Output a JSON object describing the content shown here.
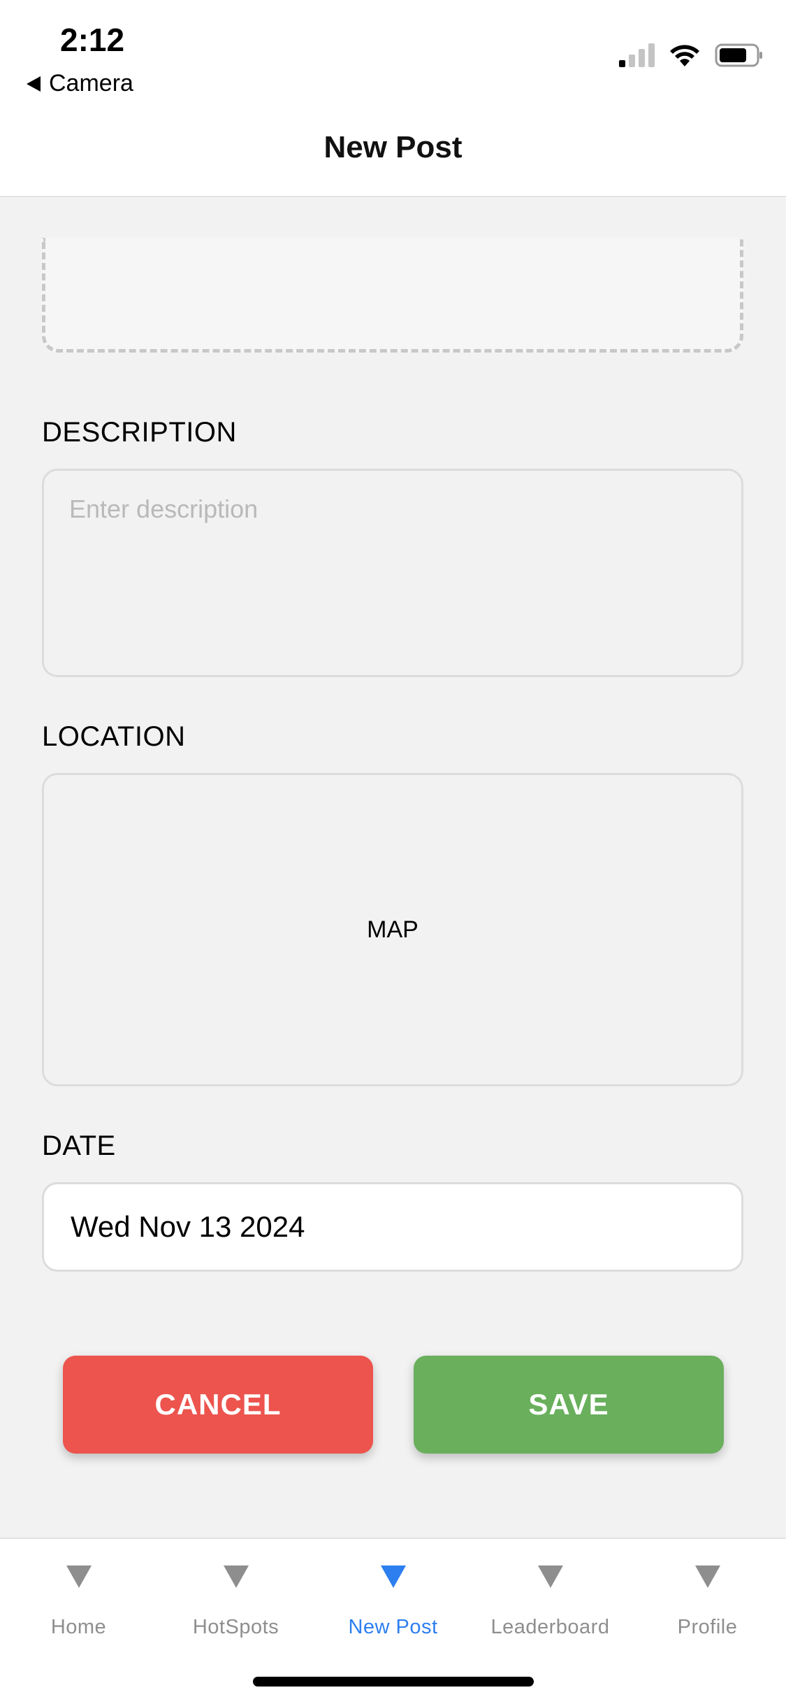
{
  "status_bar": {
    "time": "2:12",
    "back_label": "Camera",
    "signal_icon": "cellular-signal-icon",
    "wifi_icon": "wifi-icon",
    "battery_icon": "battery-icon"
  },
  "nav": {
    "title": "New Post"
  },
  "form": {
    "description_label": "DESCRIPTION",
    "description_placeholder": "Enter description",
    "location_label": "LOCATION",
    "map_text": "MAP",
    "date_label": "DATE",
    "date_value": "Wed Nov 13 2024"
  },
  "actions": {
    "cancel_label": "CANCEL",
    "save_label": "SAVE"
  },
  "tabbar": {
    "items": [
      {
        "label": "Home",
        "icon": "triangle-down-icon"
      },
      {
        "label": "HotSpots",
        "icon": "triangle-down-icon"
      },
      {
        "label": "New Post",
        "icon": "triangle-down-icon",
        "active": true
      },
      {
        "label": "Leaderboard",
        "icon": "triangle-down-icon"
      },
      {
        "label": "Profile",
        "icon": "triangle-down-icon"
      }
    ]
  },
  "colors": {
    "accent": "#2d7ff0",
    "cancel": "#ec544d",
    "save": "#69af5c",
    "background": "#f2f2f2"
  }
}
